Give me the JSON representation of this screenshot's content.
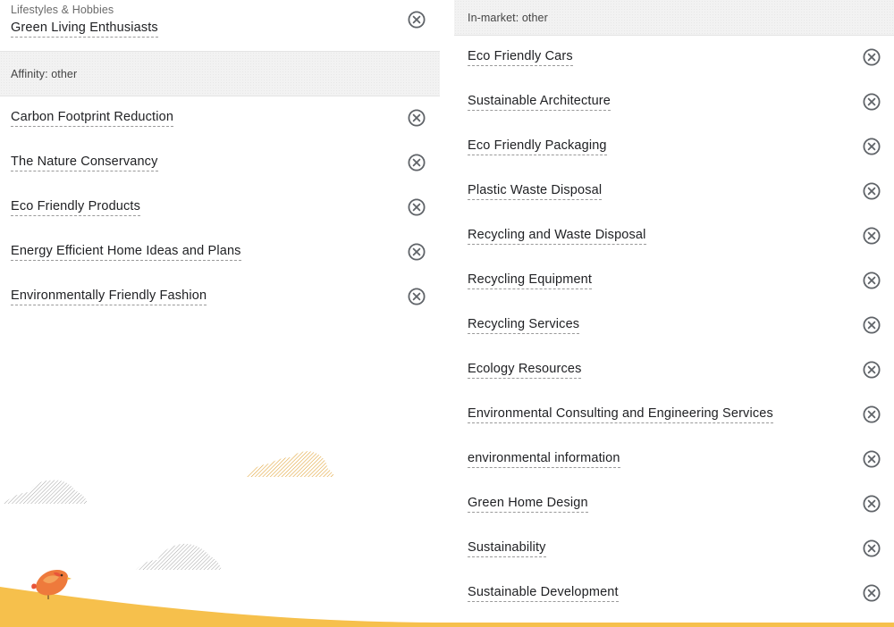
{
  "colors": {
    "accent_yellow": "#f6c04c",
    "header_bg": "#f2f2f2",
    "text": "#202124",
    "muted_text": "#6b6b6b",
    "icon": "#5f6368"
  },
  "left": {
    "top_item": {
      "category": "Lifestyles & Hobbies",
      "label": "Green Living Enthusiasts"
    },
    "section_title": "Affinity: other",
    "items": [
      {
        "label": "Carbon Footprint Reduction"
      },
      {
        "label": "The Nature Conservancy"
      },
      {
        "label": "Eco Friendly Products"
      },
      {
        "label": "Energy Efficient Home Ideas and Plans"
      },
      {
        "label": "Environmentally Friendly Fashion"
      }
    ]
  },
  "right": {
    "section_title": "In-market: other",
    "items": [
      {
        "label": "Eco Friendly Cars"
      },
      {
        "label": "Sustainable Architecture"
      },
      {
        "label": "Eco Friendly Packaging"
      },
      {
        "label": "Plastic Waste Disposal"
      },
      {
        "label": "Recycling and Waste Disposal"
      },
      {
        "label": "Recycling Equipment"
      },
      {
        "label": "Recycling Services"
      },
      {
        "label": "Ecology Resources"
      },
      {
        "label": "Environmental Consulting and Engineering Services"
      },
      {
        "label": "environmental information"
      },
      {
        "label": "Green Home Design"
      },
      {
        "label": "Sustainability"
      },
      {
        "label": "Sustainable Development"
      }
    ]
  },
  "icons": {
    "remove": "close-circle-icon",
    "decoration": [
      "cloud-icon",
      "bird-icon",
      "hill-shape"
    ]
  }
}
